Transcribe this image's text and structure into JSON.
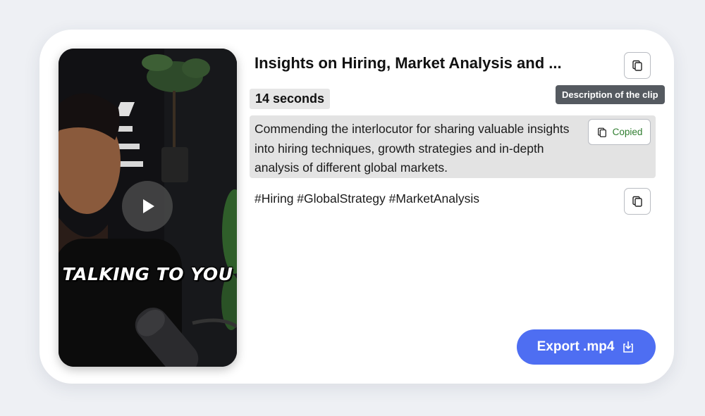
{
  "video": {
    "caption": "TALKING TO YOU",
    "play_icon": "play-icon"
  },
  "clip": {
    "title": "Insights on Hiring, Market Analysis and ...",
    "duration": "14 seconds",
    "tooltip": "Description of the clip",
    "description": "Commending the interlocutor for sharing valuable insights into hiring techniques, growth strategies and in-depth analysis of different global markets.",
    "copied_label": "Copied",
    "hashtags": "#Hiring #GlobalStrategy #MarketAnalysis"
  },
  "actions": {
    "export_label": "Export .mp4",
    "copy_icon": "copy-icon",
    "download_icon": "download-icon"
  },
  "colors": {
    "accent": "#4e6ef2",
    "copied_text": "#2f7d2f",
    "tooltip_bg": "#555a60",
    "highlight_bg": "#e3e3e3"
  }
}
